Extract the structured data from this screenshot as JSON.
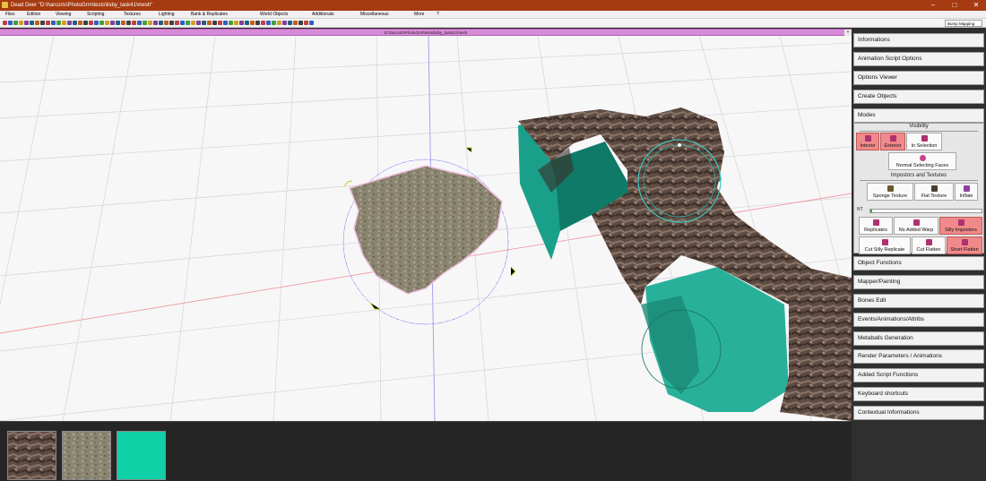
{
  "window": {
    "title": "Dead Deer \"D:\\harcoris\\PhotoGrm\\tests\\lisby_task41\\mesh\"",
    "minimize_glyph": "–",
    "maximize_glyph": "□",
    "close_glyph": "✕"
  },
  "menu": [
    "Files",
    "Edition",
    "Viewing",
    "Scripting",
    "Textures",
    "Lighting",
    "Bank & Replicates",
    "World Objects",
    "Additionals",
    "Miscellaneous",
    "More",
    "?"
  ],
  "toolbar": {
    "mode_select": "Bump Mapping"
  },
  "pathbar": {
    "path": "D:\\harcoris\\PhotoGrm\\tests\\lisby_task41\\mesh",
    "button": "+"
  },
  "texture_strip": {
    "thumbnails": [
      {
        "name": "stone-wall-texture",
        "color": "#7a6252"
      },
      {
        "name": "ground-texture",
        "color": "#8e8a6a"
      },
      {
        "name": "flat-teal-texture",
        "color": "#10d0a8"
      }
    ]
  },
  "sidepanel": {
    "sections_top": [
      "Informations",
      "Animation Script Options",
      "Options Viewer",
      "Create Objects",
      "Modes"
    ],
    "modes": {
      "visibility_label": "Visibility",
      "interior": "Interior",
      "exterior": "Exterior",
      "in_selection": "In Selection",
      "normal_selecting_faces": "Normal Selecting Faces",
      "impostors_label": "Impostors and Textures",
      "sponge_texture": "Sponge Texture",
      "flat_texture": "Flat Texture",
      "inflate": "Inflate",
      "nt_label": "NT",
      "nt_level": 0.02,
      "replicates": "Replicates",
      "no_added_warp": "No Added Warp",
      "silly_impostors": "Silly Impostors",
      "cut_silly_replicate": "Cut Silly Replicate",
      "cut_flatten": "Cut Flatten",
      "short_flatten": "Short Flatten"
    },
    "sections_bottom": [
      "Object Functions",
      "Mapper/Painting",
      "Bones Edit",
      "Events/Animations/Attribs",
      "Metaballs Generation",
      "Render Parameters / Animations",
      "Added Script Functions",
      "Keyboard shortcuts",
      "Contextual Informations"
    ]
  },
  "colors": {
    "title_bar": "#a63a10",
    "path_bar": "#d88ad8",
    "mode_active": "#f08a8a",
    "teal": "#1aa08a"
  }
}
